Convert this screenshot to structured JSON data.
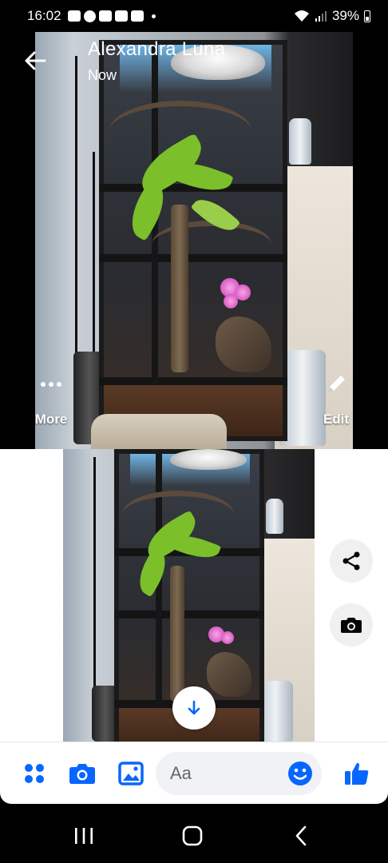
{
  "status_bar": {
    "time": "16:02",
    "battery": "39%",
    "notification_icons": [
      "snapchat-icon",
      "facebook-icon",
      "snapchat-icon",
      "youtube-icon",
      "youtube-icon"
    ]
  },
  "viewer": {
    "sender_name": "Alexandra Luna",
    "sender_time": "Now",
    "more_label": "More",
    "edit_label": "Edit"
  },
  "chat": {
    "actions": [
      "share-icon",
      "camera-icon"
    ],
    "scroll_icon": "arrow-down-icon"
  },
  "composer": {
    "placeholder": "Aa",
    "buttons": [
      "menu-grid-icon",
      "camera-icon",
      "gallery-icon",
      "emoji-icon",
      "thumbs-up-icon"
    ]
  },
  "nav_bar": {
    "buttons": [
      "recents-icon",
      "home-icon",
      "back-icon"
    ]
  },
  "colors": {
    "accent": "#0866ff",
    "background_dark": "#000000",
    "composer_input_bg": "#f0f2f5"
  }
}
